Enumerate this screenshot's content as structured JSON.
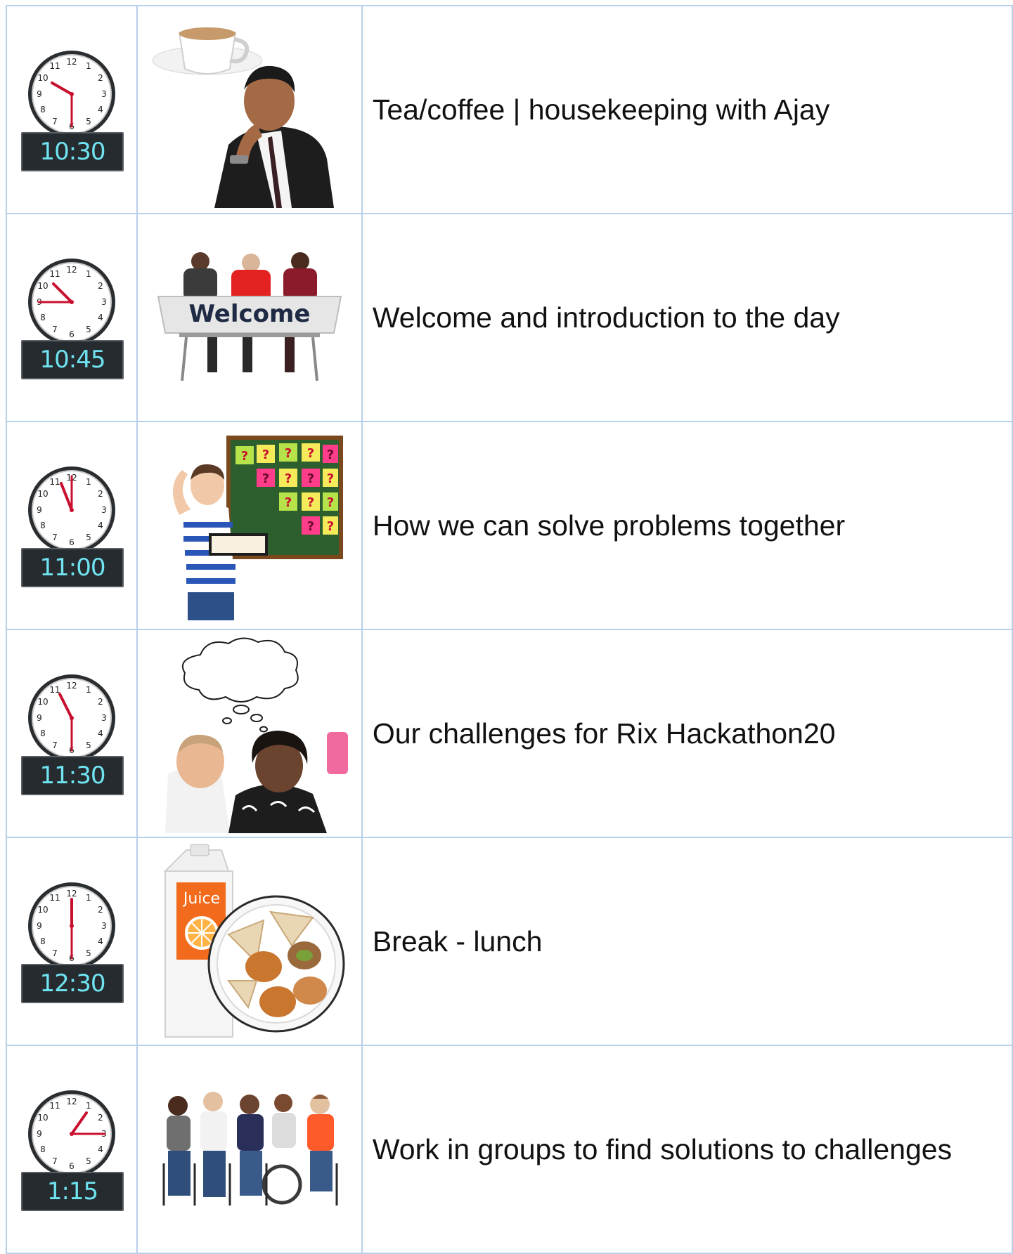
{
  "colors": {
    "grid_border": "#b8d0ea",
    "digital_bg": "#252b2f",
    "digital_text": "#6fe3f0",
    "clock_hand": "#c8102e"
  },
  "rows": [
    {
      "time": "10:30",
      "activity": "Tea/coffee | housekeeping with Ajay",
      "picture": "tea-coffee-man-thinking-icon"
    },
    {
      "time": "10:45",
      "activity": "Welcome and introduction to the day",
      "picture": "welcome-sign-panel-icon",
      "sign_text": "Welcome"
    },
    {
      "time": "11:00",
      "activity": "How we can solve problems together",
      "picture": "man-question-board-icon"
    },
    {
      "time": "11:30",
      "activity": "Our challenges for Rix Hackathon20",
      "picture": "two-people-thought-bubble-icon"
    },
    {
      "time": "12:30",
      "activity": "Break - lunch",
      "picture": "juice-and-sandwiches-icon",
      "carton_text": "Juice"
    },
    {
      "time": "1:15",
      "activity": "Work in groups to find solutions to challenges",
      "picture": "group-seated-people-icon"
    }
  ]
}
